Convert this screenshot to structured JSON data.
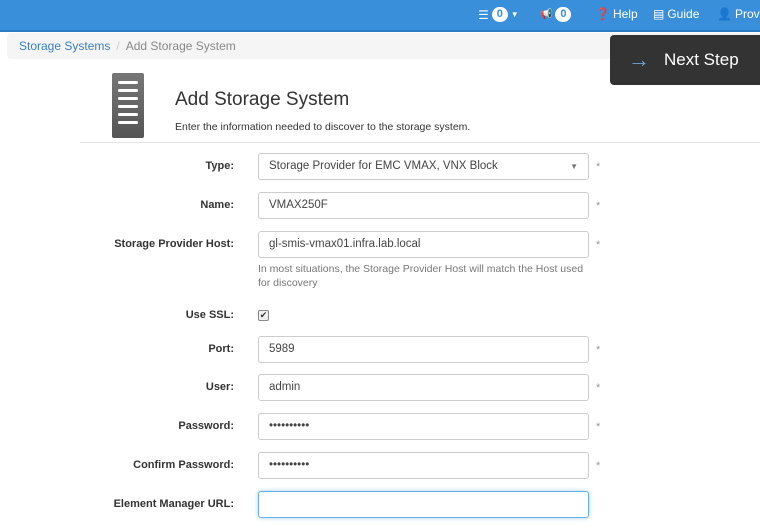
{
  "topbar": {
    "tasks_count": "0",
    "notifications_count": "0",
    "help": "Help",
    "guide": "Guide",
    "user": "Provid"
  },
  "breadcrumb": {
    "parent": "Storage Systems",
    "separator": "/",
    "current": "Add Storage System"
  },
  "next_step": {
    "label": "Next Step",
    "icon": "arrow-right-icon"
  },
  "header": {
    "title": "Add Storage System",
    "subtitle": "Enter the information needed to discover to the storage system.",
    "icon": "server-icon"
  },
  "form": {
    "type": {
      "label": "Type:",
      "value": "Storage Provider for EMC VMAX, VNX Block"
    },
    "name": {
      "label": "Name:",
      "value": "VMAX250F"
    },
    "host": {
      "label": "Storage Provider Host:",
      "value": "gl-smis-vmax01.infra.lab.local",
      "help": "In most situations, the Storage Provider Host will match the Host used for discovery"
    },
    "ssl": {
      "label": "Use SSL:",
      "checked": true,
      "mark": "✔"
    },
    "port": {
      "label": "Port:",
      "value": "5989"
    },
    "user": {
      "label": "User:",
      "value": "admin"
    },
    "password": {
      "label": "Password:",
      "value": "••••••••••"
    },
    "confirm": {
      "label": "Confirm Password:",
      "value": "••••••••••"
    },
    "emurl": {
      "label": "Element Manager URL:",
      "value": ""
    },
    "required_mark": "*"
  },
  "colors": {
    "topbar": "#3a8fdb",
    "link": "#3a7fc1",
    "next_step_bg": "#333333"
  }
}
